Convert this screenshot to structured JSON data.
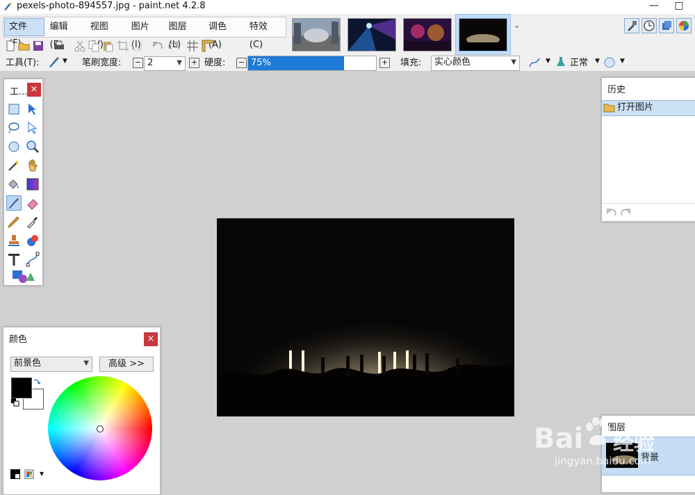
{
  "window": {
    "title": "pexels-photo-894557.jpg - paint.net 4.2.8",
    "minimize": "—",
    "maximize": "□"
  },
  "menu": {
    "items": [
      {
        "id": "file",
        "label": "文件(F)"
      },
      {
        "id": "edit",
        "label": "编辑(E)"
      },
      {
        "id": "view",
        "label": "视图(V)"
      },
      {
        "id": "image",
        "label": "图片(I)"
      },
      {
        "id": "layers",
        "label": "图层(L)"
      },
      {
        "id": "adjust",
        "label": "调色(A)"
      },
      {
        "id": "effects",
        "label": "特效(C)"
      }
    ]
  },
  "toolbar2": {
    "tool_label": "工具(T):",
    "brush_width_label": "笔刷宽度:",
    "brush_width_value": "2",
    "hardness_label": "硬度:",
    "hardness_value": "75%",
    "hardness_level": 0.75,
    "fill_label": "填充:",
    "fill_value": "实心颜色",
    "blend_value": "正常",
    "minus": "−",
    "plus": "+"
  },
  "tools_panel": {
    "title": "工...",
    "close": "×"
  },
  "history_panel": {
    "title": "历史",
    "items": [
      {
        "label": "打开图片"
      }
    ]
  },
  "colors_panel": {
    "title": "颜色",
    "close": "×",
    "mode_value": "前景色",
    "advanced_label": "高级 >>",
    "primary_color": "#000000",
    "secondary_color": "#ffffff"
  },
  "layers_panel": {
    "title": "图层",
    "items": [
      {
        "label": "背景"
      }
    ]
  },
  "watermark": {
    "brand": "Bai",
    "brand2": "经验",
    "url": "jingyan.baidu.com"
  },
  "colors": {
    "accent": "#1e7ad6",
    "close_red": "#c8373d",
    "select_bg": "#cce0f5"
  }
}
